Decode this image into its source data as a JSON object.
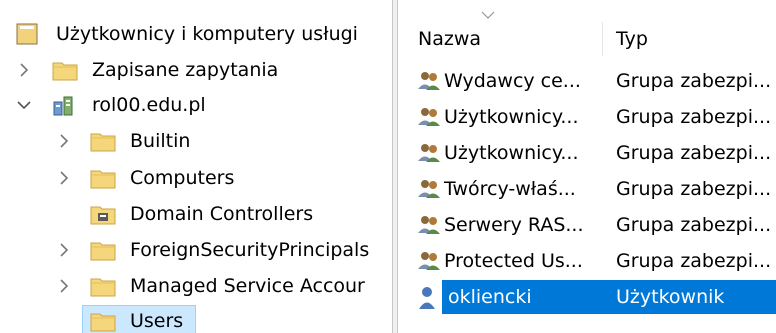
{
  "tree": {
    "root_label": "Użytkownicy i komputery usługi",
    "items": [
      {
        "label": "Zapisane zapytania",
        "icon": "folder-icon",
        "expander": "chevron-right-icon"
      },
      {
        "label": "rol00.edu.pl",
        "icon": "domain-icon",
        "expander": "chevron-down-icon"
      },
      {
        "label": "Builtin",
        "icon": "folder-icon",
        "expander": "chevron-right-icon"
      },
      {
        "label": "Computers",
        "icon": "folder-icon",
        "expander": "chevron-right-icon"
      },
      {
        "label": "Domain Controllers",
        "icon": "ou-folder-icon",
        "expander": ""
      },
      {
        "label": "ForeignSecurityPrincipals",
        "icon": "folder-icon",
        "expander": "chevron-right-icon"
      },
      {
        "label": "Managed Service Accour",
        "icon": "folder-icon",
        "expander": "chevron-right-icon"
      },
      {
        "label": "Users",
        "icon": "folder-icon",
        "expander": ""
      }
    ]
  },
  "list": {
    "columns": [
      {
        "label": "Nazwa"
      },
      {
        "label": "Typ"
      }
    ],
    "rows": [
      {
        "name": "Wydawcy ce...",
        "type": "Grupa zabezpi...",
        "icon": "group-icon",
        "selected": false
      },
      {
        "name": "Użytkownicy...",
        "type": "Grupa zabezpi...",
        "icon": "group-icon",
        "selected": false
      },
      {
        "name": "Użytkownicy...",
        "type": "Grupa zabezpi...",
        "icon": "group-icon",
        "selected": false
      },
      {
        "name": "Twórcy-właś...",
        "type": "Grupa zabezpi...",
        "icon": "group-icon",
        "selected": false
      },
      {
        "name": "Serwery RAS...",
        "type": "Grupa zabezpi...",
        "icon": "group-icon",
        "selected": false
      },
      {
        "name": "Protected Us...",
        "type": "Grupa zabezpi...",
        "icon": "group-icon",
        "selected": false
      },
      {
        "name": "okliencki",
        "type": "Użytkownik",
        "icon": "user-icon",
        "selected": true
      }
    ]
  },
  "colors": {
    "selection": "#0078d7",
    "tree_selection": "#cce8ff",
    "folder": "#f6d67a"
  }
}
